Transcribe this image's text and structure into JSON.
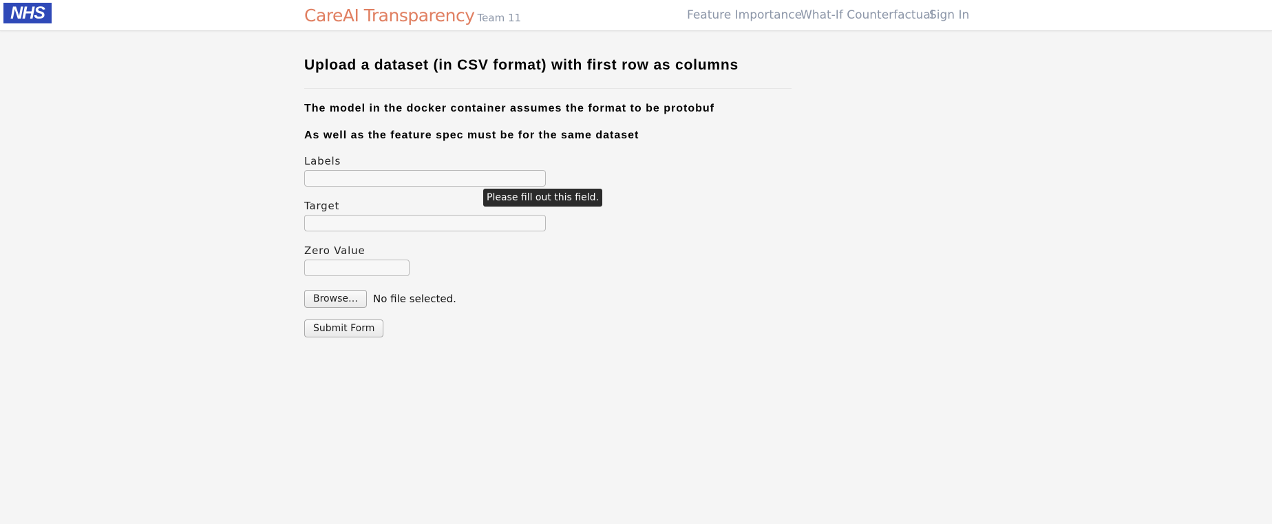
{
  "header": {
    "logo_text": "NHS",
    "brand_title": "CareAI Transparency",
    "brand_subtitle": "Team 11",
    "nav": [
      {
        "label": "Feature Importance"
      },
      {
        "label": "What-If Counterfactual"
      },
      {
        "label": "Sign In"
      }
    ]
  },
  "main": {
    "heading": "Upload a dataset (in CSV format) with first row as columns",
    "note1": "The model in the docker container assumes the format to be protobuf",
    "note2": "As well as the feature spec must be for the same dataset",
    "fields": {
      "labels": {
        "label": "Labels",
        "value": ""
      },
      "target": {
        "label": "Target",
        "value": ""
      },
      "zero_value": {
        "label": "Zero Value",
        "value": ""
      }
    },
    "file": {
      "button_label": "Browse…",
      "status": "No file selected."
    },
    "submit_label": "Submit Form",
    "tooltip": "Please fill out this field."
  },
  "colors": {
    "brand": "#e07f61",
    "nav": "#8c96a8",
    "logo_bg": "#2f49b8",
    "background": "#f5f5f5"
  }
}
